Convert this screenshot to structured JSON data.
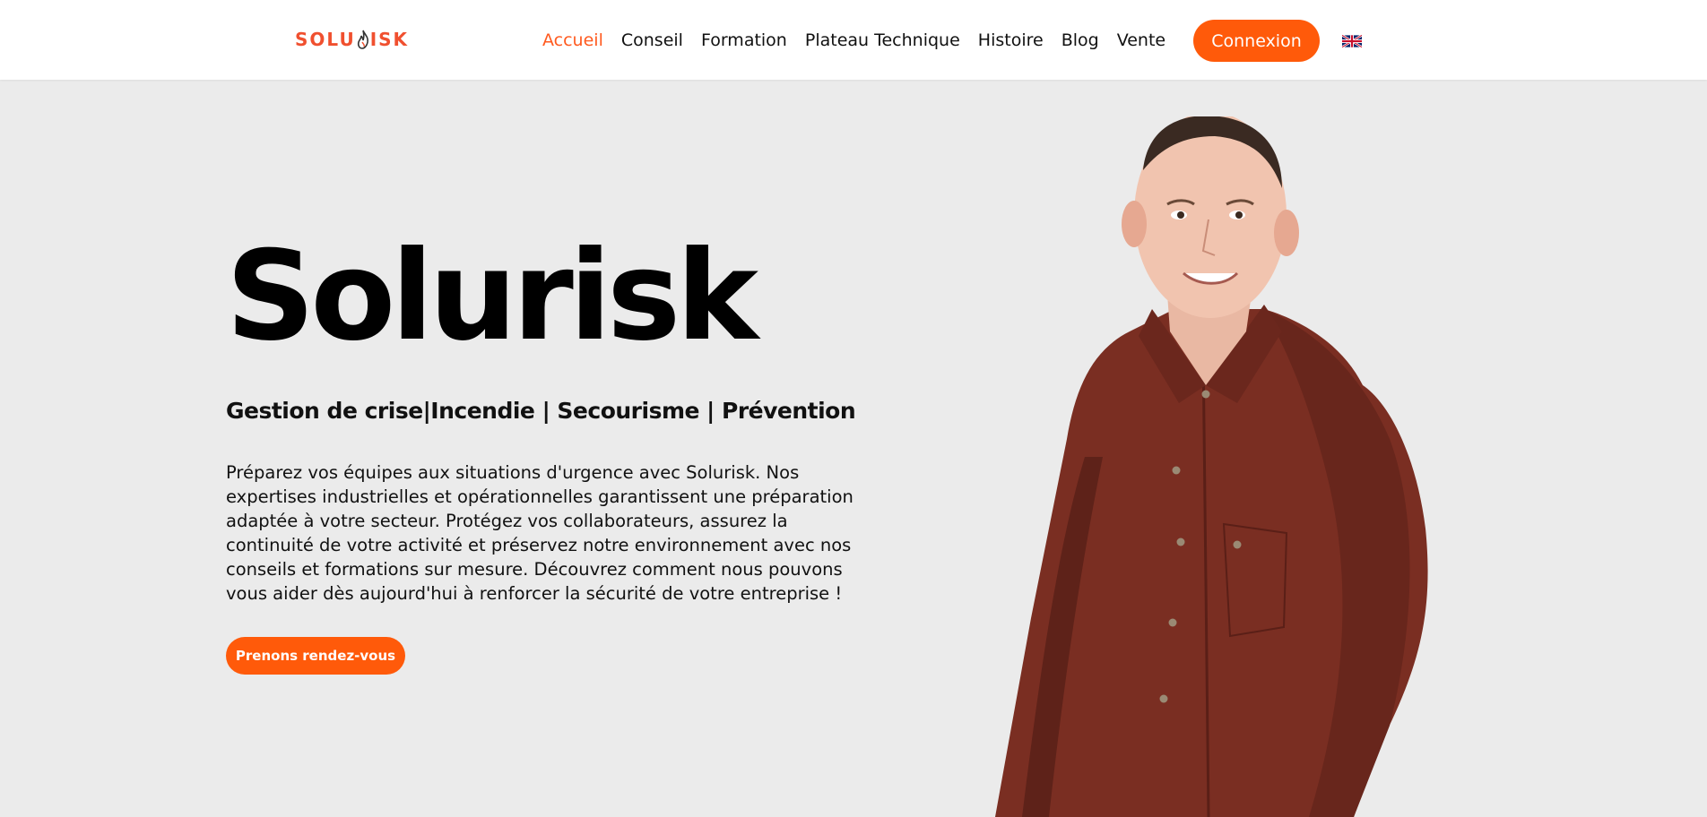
{
  "header": {
    "logo_text_left": "SOLU",
    "logo_text_right": "ISK",
    "nav": [
      {
        "label": "Accueil",
        "active": true
      },
      {
        "label": "Conseil"
      },
      {
        "label": "Formation"
      },
      {
        "label": "Plateau Technique"
      },
      {
        "label": "Histoire"
      },
      {
        "label": "Blog"
      },
      {
        "label": "Vente"
      }
    ],
    "login_label": "Connexion",
    "language_icon": "uk-flag-icon"
  },
  "hero": {
    "title": "Solurisk",
    "subtitle": "Gestion de crise|Incendie | Secourisme | Prévention",
    "description": "Préparez vos équipes aux situations d'urgence avec Solurisk. Nos expertises industrielles et opérationnelles garantissent une préparation adaptée à votre secteur. Protégez vos collaborateurs, assurez la continuité de votre activité et préservez notre environnement avec nos conseils et formations sur mesure. Découvrez comment nous pouvons vous aider dès aujourd'hui à renforcer la sécurité de votre entreprise !",
    "cta_label": "Prenons rendez-vous"
  },
  "colors": {
    "accent": "#ff5a0a",
    "brand": "#f0502f",
    "background": "#ebebeb",
    "shirt": "#7a2e22"
  }
}
